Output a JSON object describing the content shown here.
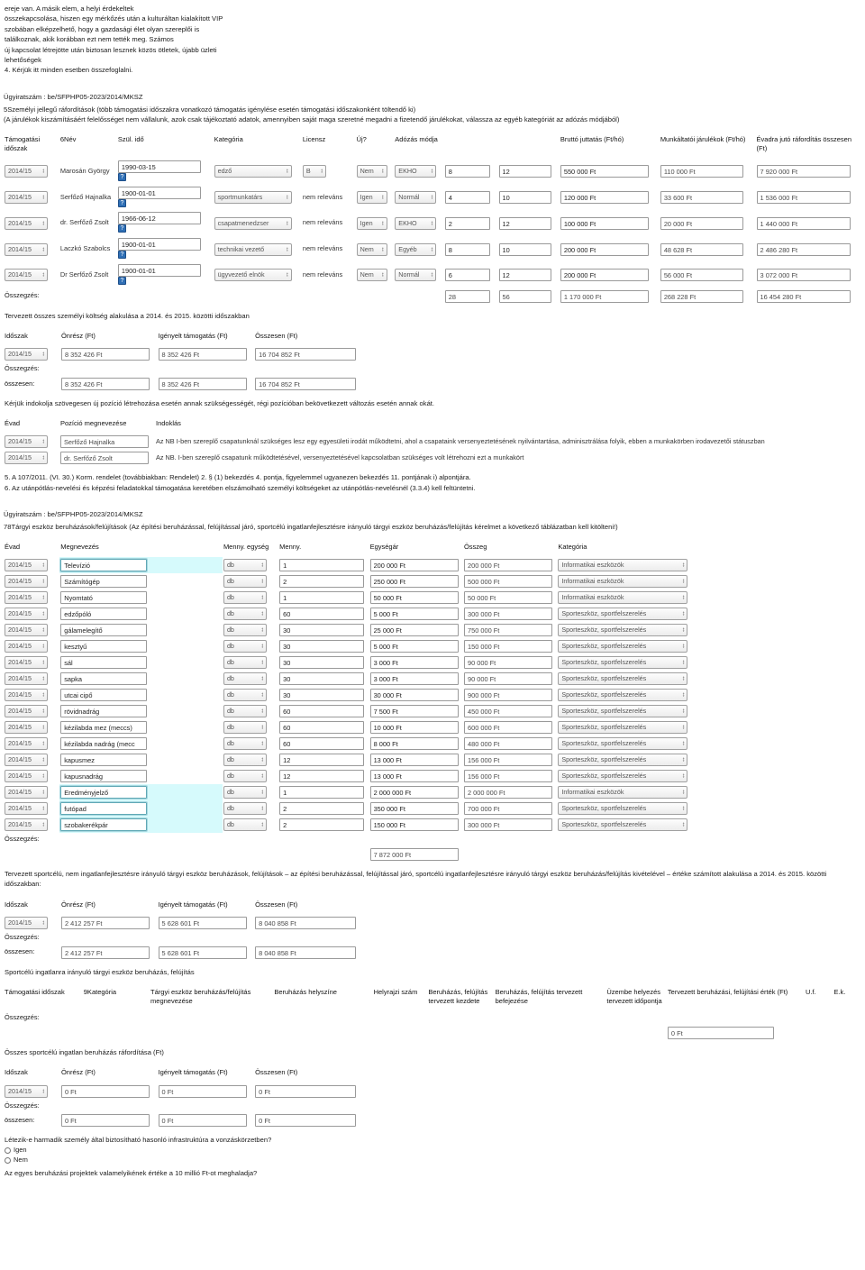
{
  "intro": {
    "lines": [
      "ereje van. A másik elem, a helyi érdekeltek",
      "összekapcsolása, hiszen egy mérkőzés után a kulturáltan kialakított VIP",
      "szobában elképzelhető, hogy a gazdasági élet olyan szereplői is",
      "találkoznak, akik korábban ezt nem tették meg. Számos",
      "új kapcsolat létrejötte után biztosan lesznek közös ötletek, újabb üzleti",
      "lehetőségek",
      "4. Kérjük itt minden esetben összefoglalni."
    ]
  },
  "personnel": {
    "doc_id": "Ügyiratszám : be/SFPHP05-2023/2014/MKSZ",
    "section_title": "5Személyi jellegű ráfordítások (több támogatási időszakra vonatkozó támogatás igénylése esetén támogatási időszakonként töltendő ki)",
    "section_note": "(A járulékok kiszámításáért felelősséget nem vállalunk, azok csak tájékoztató adatok, amennyiben saját maga szeretné megadni a fizetendő járulékokat, válassza az egyéb kategóriát az adózás módjából)",
    "headers": {
      "period": "Támogatási időszak",
      "name": "6Név",
      "birth": "Szül. idő",
      "category": "Kategória",
      "license": "Licensz",
      "new": "Új?",
      "tax": "Adózás módja",
      "gross": "Bruttó juttatás (Ft/hó)",
      "contrib": "Munkáltatói járulékok (Ft/hó)",
      "season_total": "Évadra jutó ráfordítás összesen (Ft)"
    },
    "rows": [
      {
        "period": "2014/15",
        "name": "Marosán György",
        "birth": "1990-03-15",
        "category": "edző",
        "license": "B",
        "license_is_select": true,
        "new": "Nem",
        "tax": "EKHO",
        "months": "8",
        "count": "12",
        "gross": "550 000 Ft",
        "contrib": "110 000  Ft",
        "season_total": "7 920 000  Ft",
        "highlight": false
      },
      {
        "period": "2014/15",
        "name": "Serfőző Hajnalka",
        "birth": "1900-01-01",
        "category": "sportmunkatárs",
        "license": "nem releváns",
        "license_is_select": false,
        "new": "Igen",
        "tax": "Normál",
        "months": "4",
        "count": "10",
        "gross": "120 000 Ft",
        "contrib": "33 600  Ft",
        "season_total": "1 536 000  Ft",
        "highlight": false
      },
      {
        "period": "2014/15",
        "name": "dr. Serfőző Zsolt",
        "birth": "1966-06-12",
        "category": "csapatmenedzser",
        "license": "nem releváns",
        "license_is_select": false,
        "new": "Igen",
        "tax": "EKHO",
        "months": "2",
        "count": "12",
        "gross": "100 000 Ft",
        "contrib": "20 000  Ft",
        "season_total": "1 440 000  Ft",
        "highlight": false
      },
      {
        "period": "2014/15",
        "name": "Laczkó Szabolcs",
        "birth": "1900-01-01",
        "category": "technikai vezető",
        "license": "nem releváns",
        "license_is_select": false,
        "new": "Nem",
        "tax": "Egyéb",
        "months": "8",
        "count": "10",
        "gross": "200 000 Ft",
        "contrib": "48 628 Ft",
        "season_total": "2 486 280  Ft",
        "highlight": false
      },
      {
        "period": "2014/15",
        "name": "Dr Serfőző Zsolt",
        "birth": "1900-01-01",
        "category": "ügyvezető elnök",
        "license": "nem releváns",
        "license_is_select": false,
        "new": "Nem",
        "tax": "Normál",
        "months": "6",
        "count": "12",
        "gross": "200 000 Ft",
        "contrib": "56 000  Ft",
        "season_total": "3 072 000  Ft",
        "highlight": false
      }
    ],
    "summary_label": "Összegzés:",
    "summary": {
      "months": "28",
      "count": "56",
      "gross": "1 170 000  Ft",
      "contrib": "268 228  Ft",
      "season_total": "16 454 280  Ft"
    }
  },
  "personnel_cost": {
    "intro": "Tervezett összes személyi költség alakulása a 2014. és 2015. közötti időszakban",
    "headers": {
      "period": "Időszak",
      "own": "Önrész (Ft)",
      "requested": "Igényelt támogatás (Ft)",
      "total": "Összesen (Ft)"
    },
    "rows": [
      {
        "period": "2014/15",
        "own": "8 352 426 Ft",
        "requested": "8 352 426 Ft",
        "total": "16 704 852 Ft"
      }
    ],
    "summary_label": "Összegzés:",
    "total_label": "összesen:",
    "totals": {
      "own": "8 352 426 Ft",
      "requested": "8 352 426 Ft",
      "total": "16 704 852 Ft"
    }
  },
  "justification": {
    "intro": "Kérjük indokolja szövegesen új pozíció létrehozása esetén annak szükségességét, régi pozícióban bekövetkezett változás esetén annak okát.",
    "headers": {
      "season": "Évad",
      "position": "Pozíció megnevezése",
      "reason": "Indoklás"
    },
    "rows": [
      {
        "season": "2014/15",
        "position": "Serfőző Hajnalka",
        "reason": "Az NB I-ben szereplő csapatunknál szükséges lesz egy egyesületi irodát működtetni, ahol a csapataink versenyeztetésének nyilvántartása, adminisztrálása folyik, ebben a munkakörben irodavezetői státuszban"
      },
      {
        "season": "2014/15",
        "position": "dr. Serfőző Zsolt",
        "reason": "Az NB. I-ben szereplő csapatunk működtetésével, versenyeztetésével kapcsolatban szükséges volt létrehozni ezt a munkakört"
      }
    ],
    "footnotes": [
      "5. A 107/2011. (VI. 30.) Korm. rendelet (továbbiakban: Rendelet) 2. § (1) bekezdés 4. pontja, figyelemmel ugyanezen bekezdés 11. pontjának i) alpontjára.",
      "6. Az utánpótlás-nevelési és képzési feladatokkal támogatása keretében elszámolható személyi költségeket az utánpótlás-nevelésnél (3.3.4) kell feltüntetni."
    ]
  },
  "assets": {
    "doc_id": "Ügyiratszám : be/SFPHP05-2023/2014/MKSZ",
    "section_title": "78Tárgyi eszköz beruházások/felújítások (Az építési beruházással, felújítással járó, sportcélú ingatlanfejlesztésre irányuló tárgyi eszköz beruházás/felújítás kérelmet a következő táblázatban kell kitölteni!)",
    "headers": {
      "season": "Évad",
      "name": "Megnevezés",
      "unit": "Menny. egység",
      "qty": "Menny.",
      "unit_price": "Egységár",
      "amount": "Összeg",
      "category": "Kategória"
    },
    "rows": [
      {
        "season": "2014/15",
        "name": "Televízió",
        "unit": "db",
        "qty": "1",
        "unit_price": "200 000 Ft",
        "amount": "200 000  Ft",
        "category": "Informatikai eszközök",
        "highlight": true
      },
      {
        "season": "2014/15",
        "name": "Számítógép",
        "unit": "db",
        "qty": "2",
        "unit_price": "250 000 Ft",
        "amount": "500 000  Ft",
        "category": "Informatikai eszközök",
        "highlight": false
      },
      {
        "season": "2014/15",
        "name": "Nyomtató",
        "unit": "db",
        "qty": "1",
        "unit_price": "50 000 Ft",
        "amount": "50 000  Ft",
        "category": "Informatikai eszközök",
        "highlight": false
      },
      {
        "season": "2014/15",
        "name": "edzőpóló",
        "unit": "db",
        "qty": "60",
        "unit_price": "5 000 Ft",
        "amount": "300 000  Ft",
        "category": "Sporteszköz, sportfelszerelés",
        "highlight": false
      },
      {
        "season": "2014/15",
        "name": "gálamelegítő",
        "unit": "db",
        "qty": "30",
        "unit_price": "25 000 Ft",
        "amount": "750 000  Ft",
        "category": "Sporteszköz, sportfelszerelés",
        "highlight": false
      },
      {
        "season": "2014/15",
        "name": "kesztyű",
        "unit": "db",
        "qty": "30",
        "unit_price": "5 000 Ft",
        "amount": "150 000  Ft",
        "category": "Sporteszköz, sportfelszerelés",
        "highlight": false
      },
      {
        "season": "2014/15",
        "name": "sál",
        "unit": "db",
        "qty": "30",
        "unit_price": "3 000 Ft",
        "amount": "90 000  Ft",
        "category": "Sporteszköz, sportfelszerelés",
        "highlight": false
      },
      {
        "season": "2014/15",
        "name": "sapka",
        "unit": "db",
        "qty": "30",
        "unit_price": "3 000 Ft",
        "amount": "90 000  Ft",
        "category": "Sporteszköz, sportfelszerelés",
        "highlight": false
      },
      {
        "season": "2014/15",
        "name": "utcai cipő",
        "unit": "db",
        "qty": "30",
        "unit_price": "30 000 Ft",
        "amount": "900 000  Ft",
        "category": "Sporteszköz, sportfelszerelés",
        "highlight": false
      },
      {
        "season": "2014/15",
        "name": "rövidnadrág",
        "unit": "db",
        "qty": "60",
        "unit_price": "7 500 Ft",
        "amount": "450 000  Ft",
        "category": "Sporteszköz, sportfelszerelés",
        "highlight": false
      },
      {
        "season": "2014/15",
        "name": "kézilabda mez (meccs)",
        "unit": "db",
        "qty": "60",
        "unit_price": "10 000 Ft",
        "amount": "600 000  Ft",
        "category": "Sporteszköz, sportfelszerelés",
        "highlight": false
      },
      {
        "season": "2014/15",
        "name": "kézilabda nadrág (mecc",
        "unit": "db",
        "qty": "60",
        "unit_price": "8 000 Ft",
        "amount": "480 000  Ft",
        "category": "Sporteszköz, sportfelszerelés",
        "highlight": false
      },
      {
        "season": "2014/15",
        "name": "kapusmez",
        "unit": "db",
        "qty": "12",
        "unit_price": "13 000 Ft",
        "amount": "156 000  Ft",
        "category": "Sporteszköz, sportfelszerelés",
        "highlight": false
      },
      {
        "season": "2014/15",
        "name": "kapusnadrág",
        "unit": "db",
        "qty": "12",
        "unit_price": "13 000 Ft",
        "amount": "156 000  Ft",
        "category": "Sporteszköz, sportfelszerelés",
        "highlight": false
      },
      {
        "season": "2014/15",
        "name": "Eredményjelző",
        "unit": "db",
        "qty": "1",
        "unit_price": "2 000 000 Ft",
        "amount": "2 000 000  Ft",
        "category": "Informatikai eszközök",
        "highlight": true
      },
      {
        "season": "2014/15",
        "name": "futópad",
        "unit": "db",
        "qty": "2",
        "unit_price": "350 000 Ft",
        "amount": "700 000  Ft",
        "category": "Sporteszköz, sportfelszerelés",
        "highlight": true
      },
      {
        "season": "2014/15",
        "name": "szobakerékpár",
        "unit": "db",
        "qty": "2",
        "unit_price": "150 000 Ft",
        "amount": "300 000  Ft",
        "category": "Sporteszköz, sportfelszerelés",
        "highlight": true
      }
    ],
    "summary_label": "Összegzés:",
    "summary_total": "7 872 000 Ft"
  },
  "assets_cost": {
    "intro": "Tervezett sportcélú, nem ingatlanfejlesztésre irányuló tárgyi eszköz beruházások, felújítások – az építési beruházással, felújítással járó, sportcélú ingatlanfejlesztésre irányuló tárgyi eszköz beruházás/felújítás kivételével – értéke számított alakulása a 2014. és 2015. közötti időszakban:",
    "headers": {
      "period": "Időszak",
      "own": "Önrész (Ft)",
      "requested": "Igényelt támogatás (Ft)",
      "total": "Összesen (Ft)"
    },
    "rows": [
      {
        "period": "2014/15",
        "own": "2 412 257 Ft",
        "requested": "5 628 601 Ft",
        "total": "8 040 858 Ft"
      }
    ],
    "summary_label": "Összegzés:",
    "total_label": "összesen:",
    "totals": {
      "own": "2 412 257 Ft",
      "requested": "5 628 601 Ft",
      "total": "8 040 858 Ft"
    }
  },
  "real_estate": {
    "intro": "Sportcélú ingatlanra irányuló tárgyi eszköz beruházás, felújítás",
    "headers": {
      "period": "Támogatási időszak",
      "category": "9Kategória",
      "asset_name": "Tárgyi eszköz beruházás/felújítás megnevezése",
      "location": "Beruházás helyszíne",
      "parcel": "Helyrajzi szám",
      "start": "Beruházás, felújítás tervezett kezdete",
      "end": "Beruházás, felújítás tervezett befejezése",
      "commission": "Üzembe helyezés tervezett időpontja",
      "value": "Tervezett beruházási, felújítási érték (Ft)",
      "uf": "U.f.",
      "ek": "E.k."
    },
    "summary_label": "Összegzés:",
    "summary_total": "0 Ft"
  },
  "real_estate_cost": {
    "intro": "Összes sportcélú ingatlan beruházás ráfordítása (Ft)",
    "headers": {
      "period": "Időszak",
      "own": "Önrész (Ft)",
      "requested": "Igényelt támogatás (Ft)",
      "total": "Összesen (Ft)"
    },
    "rows": [
      {
        "period": "2014/15",
        "own": "0 Ft",
        "requested": "0 Ft",
        "total": "0 Ft"
      }
    ],
    "summary_label": "Összegzés:",
    "total_label": "összesen:",
    "totals": {
      "own": "0 Ft",
      "requested": "0 Ft",
      "total": "0 Ft"
    }
  },
  "questions": [
    {
      "text": "Létezik-e harmadik személy által biztosítható hasonló infrastruktúra a vonzáskörzetben?",
      "options": [
        "Igen",
        "Nem"
      ]
    },
    {
      "text": "Az egyes beruházási projektek valamelyikének értéke a 10 millió Ft-ot meghaladja?",
      "options": []
    }
  ]
}
